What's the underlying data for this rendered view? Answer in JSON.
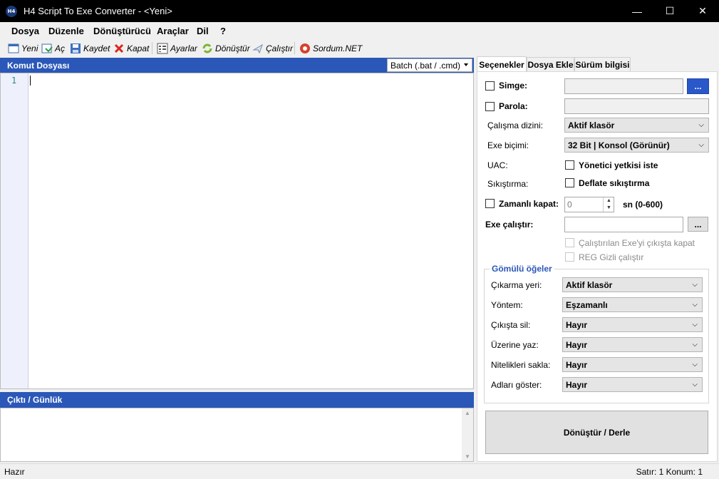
{
  "window": {
    "title": "H4 Script To Exe Converter - <Yeni>",
    "icon_text": "H4",
    "controls": [
      "—",
      "☐",
      "✕"
    ]
  },
  "menu": [
    "Dosya",
    "Düzenle",
    "Dönüştürücü",
    "Araçlar",
    "Dil",
    "?"
  ],
  "toolbar": [
    {
      "label": "Yeni",
      "icon": "new-file-icon"
    },
    {
      "label": "Aç",
      "icon": "open-icon"
    },
    {
      "label": "Kaydet",
      "icon": "save-icon"
    },
    {
      "label": "Kapat",
      "icon": "close-x-icon"
    },
    {
      "label": "Ayarlar",
      "icon": "settings-icon"
    },
    {
      "label": "Dönüştür",
      "icon": "convert-icon"
    },
    {
      "label": "Çalıştır",
      "icon": "run-icon"
    },
    {
      "label": "Sordum.NET",
      "icon": "sordum-icon"
    }
  ],
  "editor": {
    "header": "Komut Dosyası",
    "script_type": "Batch (.bat / .cmd)",
    "line_numbers": [
      "1"
    ]
  },
  "output": {
    "header": "Çıktı / Günlük"
  },
  "tabs": [
    "Seçenekler",
    "Dosya Ekle",
    "Sürüm bilgisi"
  ],
  "options": {
    "icon_label": "Simge:",
    "icon_browse": "...",
    "password_label": "Parola:",
    "workdir_label": "Çalışma dizini:",
    "workdir_value": "Aktif klasör",
    "exe_format_label": "Exe biçimi:",
    "exe_format_value": "32 Bit | Konsol (Görünür)",
    "uac_label": "UAC:",
    "uac_check": "Yönetici yetkisi iste",
    "compression_label": "Sıkıştırma:",
    "compression_check": "Deflate sıkıştırma",
    "timed_close_label": "Zamanlı kapat:",
    "timed_close_value": "0",
    "timed_close_unit": "sn (0-600)",
    "exe_run_label": "Exe çalıştır:",
    "exe_run_browse": "...",
    "close_run_exe": "Çalıştırılan Exe'yi çıkışta kapat",
    "reg_hidden": "REG Gizli çalıştır"
  },
  "embedded": {
    "title": "Gömülü öğeler",
    "rows": [
      {
        "label": "Çıkarma yeri:",
        "value": "Aktif klasör"
      },
      {
        "label": "Yöntem:",
        "value": "Eşzamanlı"
      },
      {
        "label": "Çıkışta sil:",
        "value": "Hayır"
      },
      {
        "label": "Üzerine yaz:",
        "value": "Hayır"
      },
      {
        "label": "Nitelikleri sakla:",
        "value": "Hayır"
      },
      {
        "label": "Adları göster:",
        "value": "Hayır"
      }
    ]
  },
  "convert_button": "Dönüştür / Derle",
  "status": {
    "left": "Hazır",
    "right": "Satır: 1 Konum: 1"
  }
}
